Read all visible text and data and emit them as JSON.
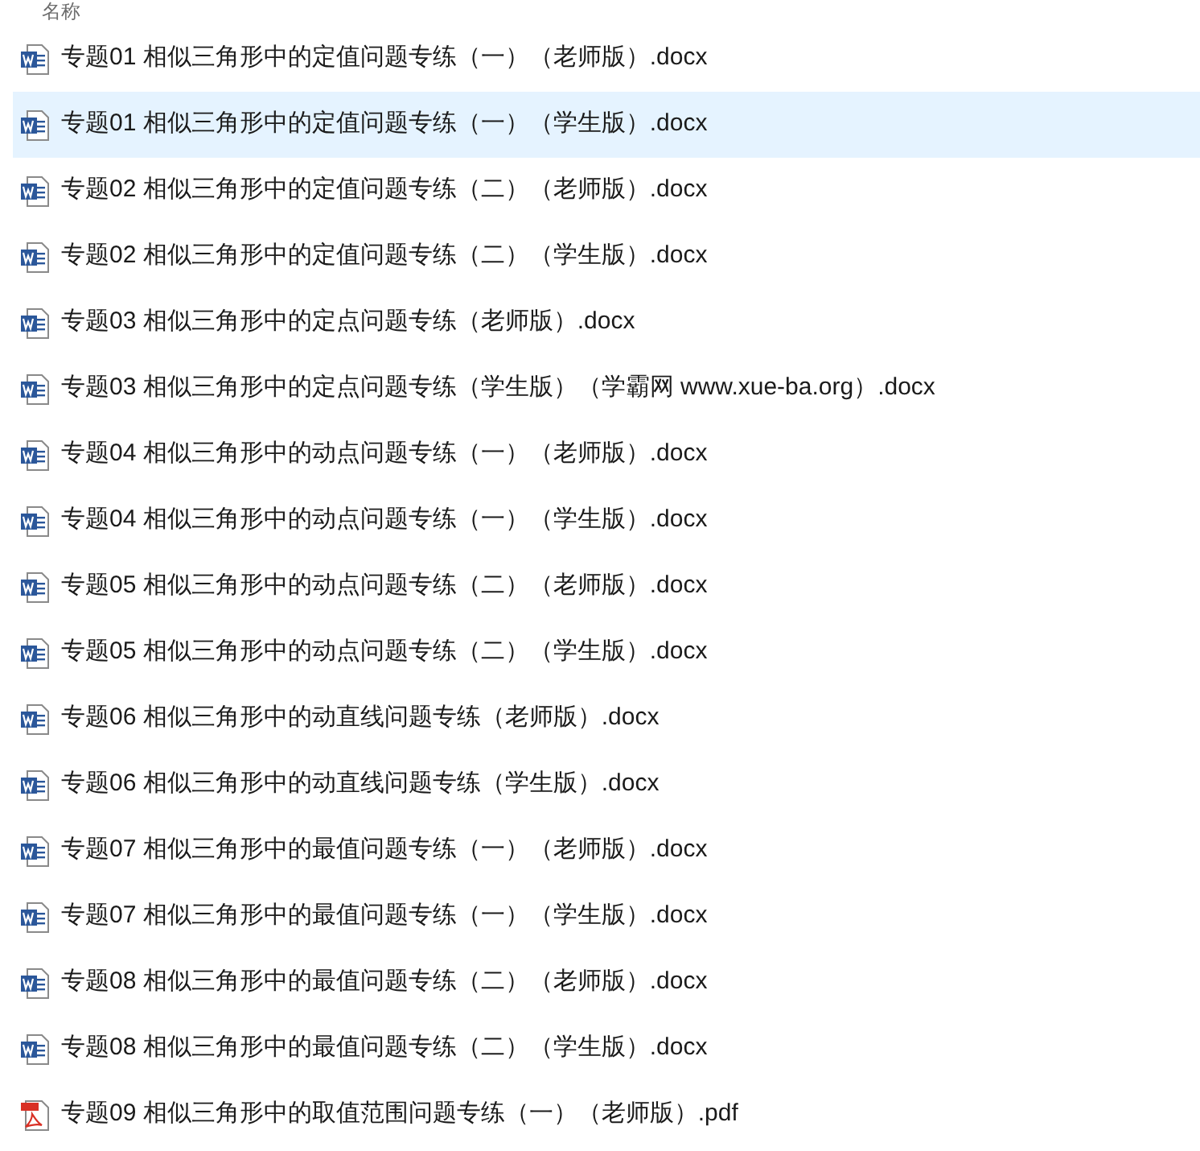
{
  "header": {
    "column_1": "名称"
  },
  "files": [
    {
      "name": "专题01 相似三角形中的定值问题专练（一）（老师版）.docx",
      "kind": "word",
      "selected": false
    },
    {
      "name": "专题01 相似三角形中的定值问题专练（一）（学生版）.docx",
      "kind": "word",
      "selected": true
    },
    {
      "name": "专题02 相似三角形中的定值问题专练（二）（老师版）.docx",
      "kind": "word",
      "selected": false
    },
    {
      "name": "专题02 相似三角形中的定值问题专练（二）（学生版）.docx",
      "kind": "word",
      "selected": false
    },
    {
      "name": "专题03 相似三角形中的定点问题专练（老师版）.docx",
      "kind": "word",
      "selected": false
    },
    {
      "name": "专题03 相似三角形中的定点问题专练（学生版）（学霸网 www.xue-ba.org）.docx",
      "kind": "word",
      "selected": false
    },
    {
      "name": "专题04 相似三角形中的动点问题专练（一）（老师版）.docx",
      "kind": "word",
      "selected": false
    },
    {
      "name": "专题04 相似三角形中的动点问题专练（一）（学生版）.docx",
      "kind": "word",
      "selected": false
    },
    {
      "name": "专题05 相似三角形中的动点问题专练（二）（老师版）.docx",
      "kind": "word",
      "selected": false
    },
    {
      "name": "专题05 相似三角形中的动点问题专练（二）（学生版）.docx",
      "kind": "word",
      "selected": false
    },
    {
      "name": "专题06 相似三角形中的动直线问题专练（老师版）.docx",
      "kind": "word",
      "selected": false
    },
    {
      "name": "专题06 相似三角形中的动直线问题专练（学生版）.docx",
      "kind": "word",
      "selected": false
    },
    {
      "name": "专题07 相似三角形中的最值问题专练（一）（老师版）.docx",
      "kind": "word",
      "selected": false
    },
    {
      "name": "专题07 相似三角形中的最值问题专练（一）（学生版）.docx",
      "kind": "word",
      "selected": false
    },
    {
      "name": "专题08 相似三角形中的最值问题专练（二）（老师版）.docx",
      "kind": "word",
      "selected": false
    },
    {
      "name": "专题08 相似三角形中的最值问题专练（二）（学生版）.docx",
      "kind": "word",
      "selected": false
    },
    {
      "name": "专题09 相似三角形中的取值范围问题专练（一）（老师版）.pdf",
      "kind": "pdf",
      "selected": false
    }
  ]
}
